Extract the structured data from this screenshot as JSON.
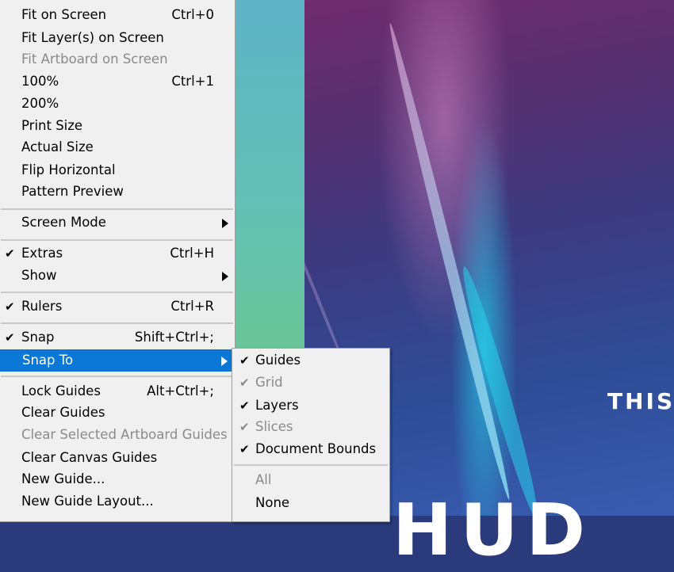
{
  "main_menu": {
    "items": [
      {
        "label": "Fit on Screen",
        "shortcut": "Ctrl+0"
      },
      {
        "label": "Fit Layer(s) on Screen",
        "shortcut": ""
      },
      {
        "label": "Fit Artboard on Screen",
        "shortcut": "",
        "disabled": true
      },
      {
        "label": "100%",
        "shortcut": "Ctrl+1"
      },
      {
        "label": "200%",
        "shortcut": ""
      },
      {
        "label": "Print Size",
        "shortcut": ""
      },
      {
        "label": "Actual Size",
        "shortcut": ""
      },
      {
        "label": "Flip Horizontal",
        "shortcut": ""
      },
      {
        "label": "Pattern Preview",
        "shortcut": ""
      },
      {
        "label": "Screen Mode",
        "submenu": true
      },
      {
        "label": "Extras",
        "shortcut": "Ctrl+H",
        "checked": true
      },
      {
        "label": "Show",
        "submenu": true
      },
      {
        "label": "Rulers",
        "shortcut": "Ctrl+R",
        "checked": true
      },
      {
        "label": "Snap",
        "shortcut": "Shift+Ctrl+;",
        "checked": true
      },
      {
        "label": "Snap To",
        "submenu": true,
        "highlighted": true
      },
      {
        "label": "Lock Guides",
        "shortcut": "Alt+Ctrl+;"
      },
      {
        "label": "Clear Guides",
        "shortcut": ""
      },
      {
        "label": "Clear Selected Artboard Guides",
        "shortcut": "",
        "disabled": true
      },
      {
        "label": "Clear Canvas Guides",
        "shortcut": ""
      },
      {
        "label": "New Guide...",
        "shortcut": ""
      },
      {
        "label": "New Guide Layout...",
        "shortcut": ""
      }
    ]
  },
  "snap_to_submenu": {
    "items": [
      {
        "label": "Guides",
        "checked": true
      },
      {
        "label": "Grid",
        "checked": true,
        "disabled": true
      },
      {
        "label": "Layers",
        "checked": true
      },
      {
        "label": "Slices",
        "checked": true,
        "disabled": true
      },
      {
        "label": "Document Bounds",
        "checked": true
      },
      {
        "label": "All",
        "disabled": true
      },
      {
        "label": "None"
      }
    ]
  },
  "check_glyph": "✔",
  "canvas": {
    "poster_text": "THIS",
    "poster_big_text": "HUD"
  },
  "colors": {
    "menu_bg": "#f0f0f0",
    "highlight": "#0b78d7",
    "disabled_text": "#8a8a8a"
  }
}
